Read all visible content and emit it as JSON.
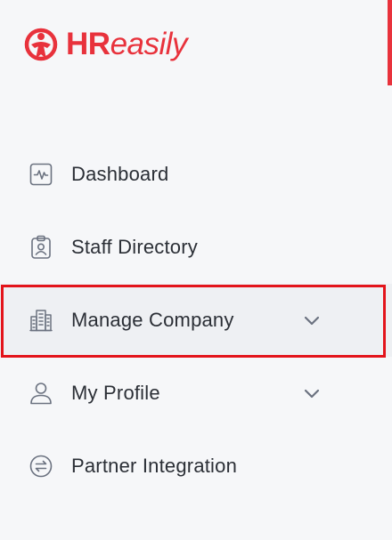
{
  "brand": {
    "name_bold": "HR",
    "name_rest": "easily",
    "color": "#e8323c"
  },
  "nav": {
    "items": [
      {
        "label": "Dashboard",
        "icon": "dashboard-chart-icon",
        "has_chevron": false
      },
      {
        "label": "Staff Directory",
        "icon": "id-badge-icon",
        "has_chevron": false
      },
      {
        "label": "Manage Company",
        "icon": "building-icon",
        "has_chevron": true,
        "active": true
      },
      {
        "label": "My Profile",
        "icon": "user-icon",
        "has_chevron": true
      },
      {
        "label": "Partner Integration",
        "icon": "swap-arrows-icon",
        "has_chevron": false
      }
    ]
  },
  "colors": {
    "background": "#f6f7f9",
    "text": "#2b2f36",
    "icon": "#6b7280",
    "highlight": "#e3141b"
  }
}
